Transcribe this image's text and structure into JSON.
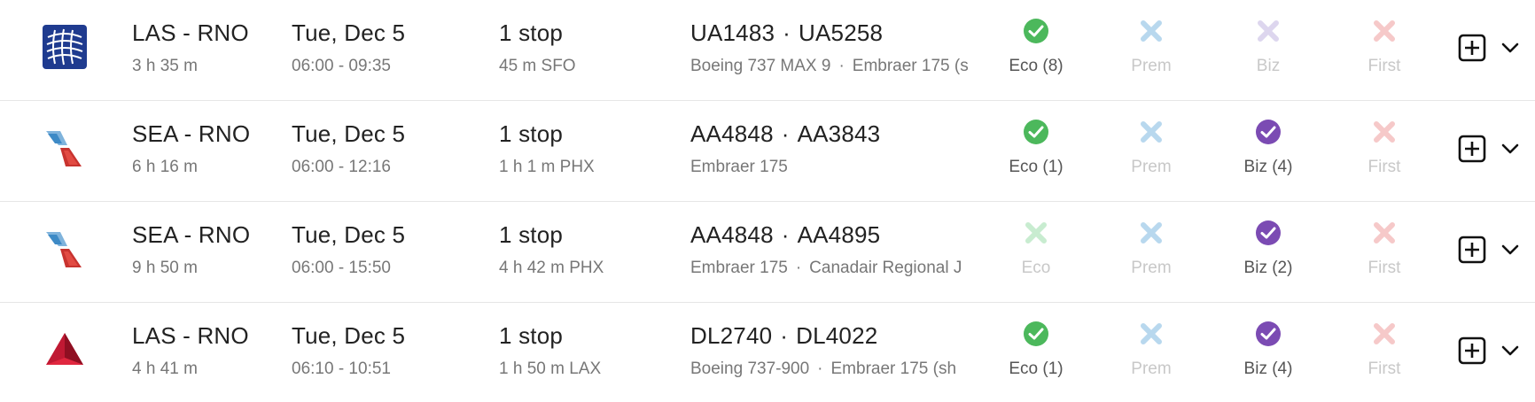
{
  "colors": {
    "available_check": "#4cb85c",
    "biz_check": "#7b4bb3",
    "prem_x": "#b8d8ee",
    "biz_x": "#ddd6ee",
    "first_x": "#f6c9c9",
    "eco_x": "#c8ecd0"
  },
  "results": [
    {
      "airline_logo": "united-airlines-globe",
      "route": "LAS - RNO",
      "duration": "3 h 35 m",
      "date": "Tue, Dec 5",
      "times": "06:00 - 09:35",
      "stops": "1 stop",
      "layover": "45 m  SFO",
      "flight_1": "UA1483",
      "flight_2": "UA5258",
      "aircraft_1": "Boeing 737 MAX 9",
      "aircraft_2": "Embraer 175 (s",
      "eco": "Eco (8)",
      "prem": "Prem",
      "biz": "Biz",
      "first": "First"
    },
    {
      "airline_logo": "american-airlines-tail",
      "route": "SEA - RNO",
      "duration": "6 h 16 m",
      "date": "Tue, Dec 5",
      "times": "06:00 - 12:16",
      "stops": "1 stop",
      "layover": "1 h 1 m  PHX",
      "flight_1": "AA4848",
      "flight_2": "AA3843",
      "aircraft_1": "Embraer 175",
      "aircraft_2": "",
      "eco": "Eco (1)",
      "prem": "Prem",
      "biz": "Biz (4)",
      "first": "First"
    },
    {
      "airline_logo": "american-airlines-tail",
      "route": "SEA - RNO",
      "duration": "9 h 50 m",
      "date": "Tue, Dec 5",
      "times": "06:00 - 15:50",
      "stops": "1 stop",
      "layover": "4 h 42 m  PHX",
      "flight_1": "AA4848",
      "flight_2": "AA4895",
      "aircraft_1": "Embraer 175",
      "aircraft_2": "Canadair Regional J",
      "eco": "Eco",
      "prem": "Prem",
      "biz": "Biz (2)",
      "first": "First"
    },
    {
      "airline_logo": "delta-widget",
      "route": "LAS - RNO",
      "duration": "4 h 41 m",
      "date": "Tue, Dec 5",
      "times": "06:10 - 10:51",
      "stops": "1 stop",
      "layover": "1 h 50 m  LAX",
      "flight_1": "DL2740",
      "flight_2": "DL4022",
      "aircraft_1": "Boeing 737-900",
      "aircraft_2": "Embraer 175 (sh",
      "eco": "Eco (1)",
      "prem": "Prem",
      "biz": "Biz (4)",
      "first": "First"
    }
  ]
}
